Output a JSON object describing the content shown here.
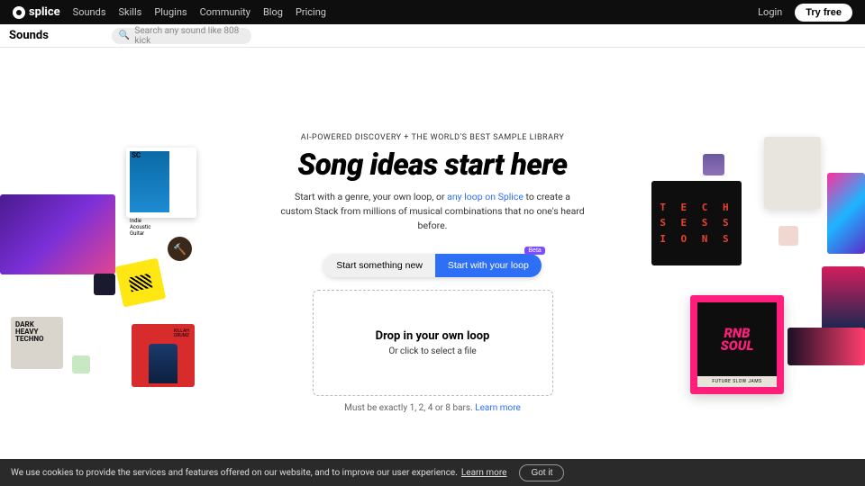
{
  "topnav": {
    "brand": "splice",
    "links": [
      "Sounds",
      "Skills",
      "Plugins",
      "Community",
      "Blog",
      "Pricing"
    ],
    "login": "Login",
    "tryfree": "Try free"
  },
  "subnav": {
    "title": "Sounds",
    "search_placeholder": "Search any sound like 808 kick"
  },
  "hero": {
    "eyebrow": "AI-POWERED DISCOVERY + THE WORLD'S BEST SAMPLE LIBRARY",
    "headline": "Song ideas start here",
    "subhead_pre": "Start with a genre, your own loop, or ",
    "subhead_link": "any loop on Splice",
    "subhead_post": " to create a custom Stack from millions of musical combinations that no one's heard before.",
    "btn_secondary": "Start something new",
    "btn_primary": "Start with your loop",
    "badge": "Beta",
    "drop_title": "Drop in your own loop",
    "drop_sub": "Or click to select a file",
    "drop_hint_pre": "Must be exactly 1, 2, 4 or 8 bars. ",
    "drop_hint_link": "Learn more"
  },
  "cookie": {
    "text": "We use cookies to provide the services and features offered on our website, and to improve our user experience.",
    "learn": "Learn more",
    "gotit": "Got it"
  },
  "tiles_left": [
    {
      "label": "Indie Acoustic Guitar"
    },
    {
      "label": "DARK HEAVY TECHNO"
    }
  ],
  "tiles_right": [
    {
      "label": "TECH SESSIONS"
    },
    {
      "label": "RNB SOUL",
      "sub": "FUTURE SLOW JAMS"
    }
  ]
}
